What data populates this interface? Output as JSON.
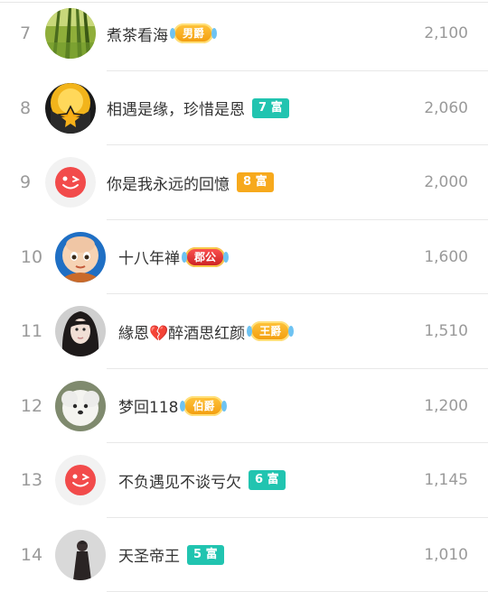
{
  "rows": [
    {
      "rank": "7",
      "name": "煮茶看海",
      "badge": "男爵",
      "badge_kind": "gold-title",
      "score": "2,100",
      "avatar": "forest-photo"
    },
    {
      "rank": "8",
      "name": "相遇是缘，珍惜是恩",
      "badge": "7 富",
      "badge_kind": "teal",
      "score": "2,060",
      "avatar": "golden-emblem"
    },
    {
      "rank": "9",
      "name": "你是我永远的回憶",
      "badge": "8 富",
      "badge_kind": "orange",
      "score": "2,000",
      "avatar": "default-wink"
    },
    {
      "rank": "10",
      "name": "十八年禅",
      "badge": "郡公",
      "badge_kind": "red-title",
      "score": "1,600",
      "avatar": "cartoon-monk"
    },
    {
      "rank": "11",
      "name": "緣恩💔醉酒思红颜",
      "badge": "王爵",
      "badge_kind": "gold-title",
      "score": "1,510",
      "avatar": "woman-portrait"
    },
    {
      "rank": "12",
      "name": "梦回118",
      "badge": "伯爵",
      "badge_kind": "gold-title",
      "score": "1,200",
      "avatar": "white-dog"
    },
    {
      "rank": "13",
      "name": "不负遇见不谈亏欠",
      "badge": "6 富",
      "badge_kind": "teal",
      "score": "1,145",
      "avatar": "default-wink"
    },
    {
      "rank": "14",
      "name": "天圣帝王",
      "badge": "5 富",
      "badge_kind": "teal",
      "score": "1,010",
      "avatar": "figure-photo"
    }
  ],
  "colors": {
    "teal": "#21c4b0",
    "orange": "#f7a91c",
    "rank_text": "#9a9a9a",
    "name_text": "#333333",
    "default_avatar_red": "#f24b4b"
  }
}
